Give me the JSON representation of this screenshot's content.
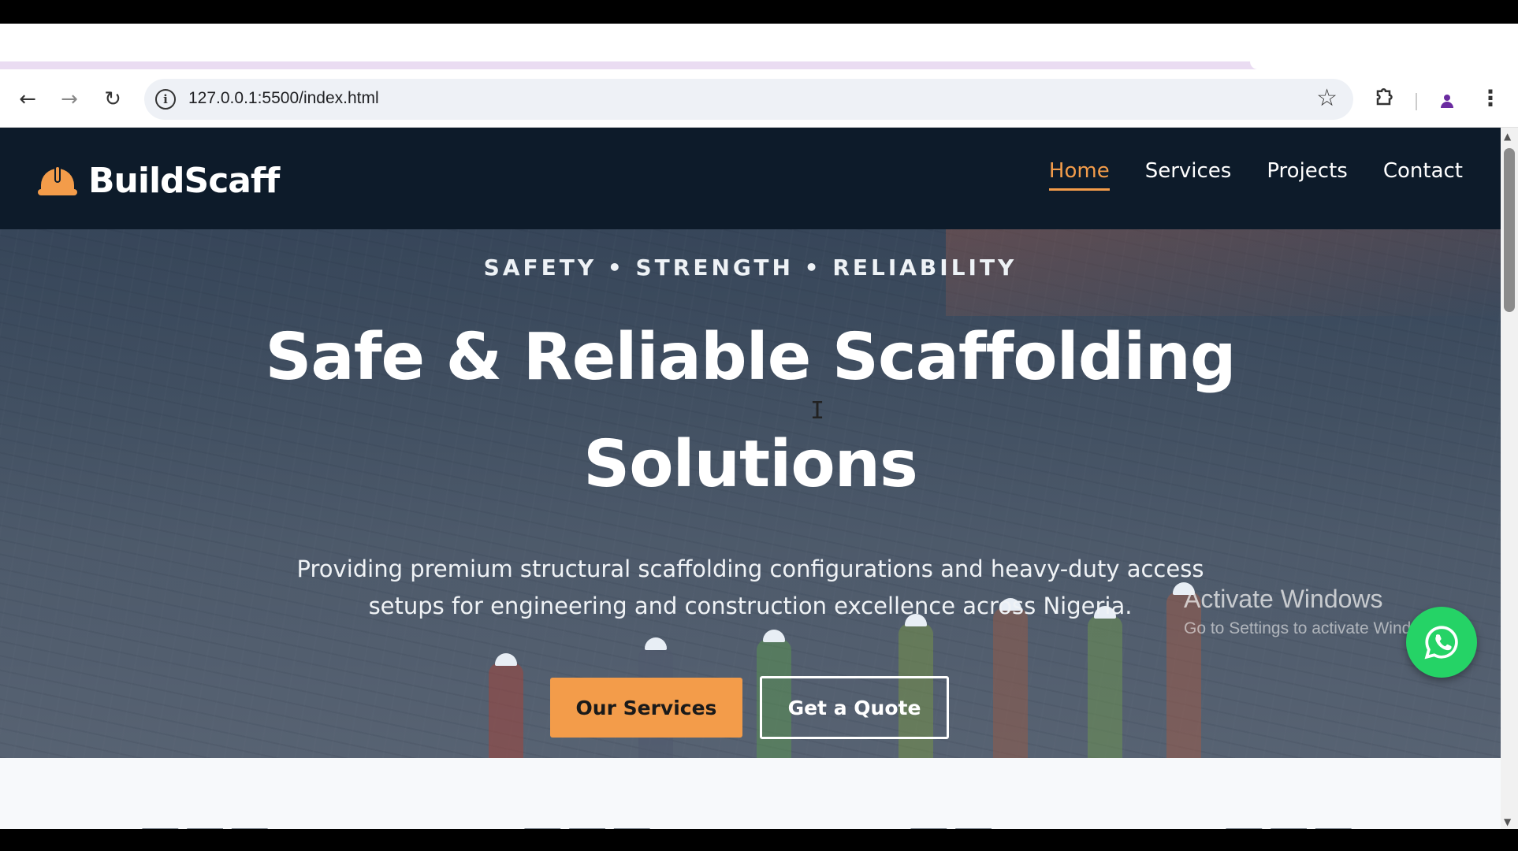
{
  "browser": {
    "url": "127.0.0.1:5500/index.html",
    "icons": {
      "back": "back-arrow-icon",
      "forward": "forward-arrow-icon",
      "reload": "reload-icon",
      "info": "site-info-icon",
      "bookmark": "star-icon",
      "extensions": "puzzle-icon",
      "profile": "profile-icon",
      "menu": "kebab-menu-icon"
    }
  },
  "site": {
    "brand": "BuildScaff",
    "brand_icon": "helmet-icon",
    "nav": [
      {
        "label": "Home",
        "active": true
      },
      {
        "label": "Services",
        "active": false
      },
      {
        "label": "Projects",
        "active": false
      },
      {
        "label": "Contact",
        "active": false
      }
    ],
    "hero": {
      "tagline": "SAFETY • STRENGTH • RELIABILITY",
      "title": "Safe & Reliable Scaffolding Solutions",
      "subtitle": "Providing premium structural scaffolding configurations and heavy-duty access setups for engineering and construction excellence across Nigeria.",
      "primary_button": "Our Services",
      "secondary_button": "Get a Quote"
    },
    "whatsapp_icon": "whatsapp-icon"
  },
  "os": {
    "watermark_title": "Activate Windows",
    "watermark_sub": "Go to Settings to activate Windows."
  },
  "colors": {
    "header_bg": "#0d1b2a",
    "accent": "#f39c4a",
    "whatsapp": "#25d366"
  }
}
